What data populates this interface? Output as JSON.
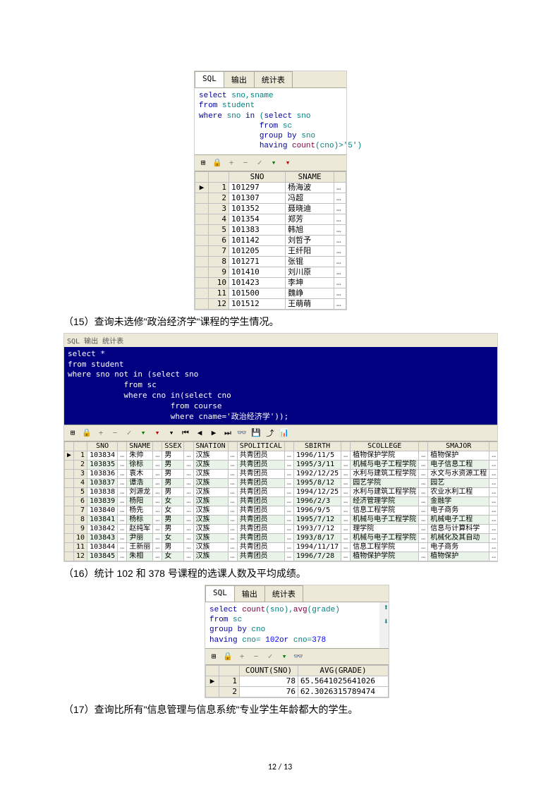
{
  "tabs": {
    "sql": "SQL",
    "output": "输出",
    "stats": "统计表"
  },
  "fig1": {
    "sql_lines": [
      {
        "pre": "",
        "kw": "select ",
        "text": "sno,sname"
      },
      {
        "pre": "",
        "kw": "from ",
        "text": "student"
      },
      {
        "pre": "",
        "kw": "where ",
        "text": "sno ",
        "kw2": "in ",
        "text2": "(",
        "kw3": "select ",
        "text3": "sno"
      },
      {
        "pre": "             ",
        "kw": "from ",
        "text": "sc"
      },
      {
        "pre": "             ",
        "kw": "group by ",
        "text": "sno"
      },
      {
        "pre": "             ",
        "kw": "having ",
        "fn": "count",
        "text": "(cno)>'5')"
      }
    ],
    "toolbar_icons": [
      "grid-icon",
      "lock-icon",
      "plus-icon",
      "minus-icon",
      "check-icon",
      "down-green-icon",
      "down-red-icon"
    ],
    "headers": [
      "SNO",
      "SNAME"
    ],
    "rows": [
      {
        "marker": "▶",
        "n": "1",
        "sno": "101297",
        "sname": "杨海波"
      },
      {
        "marker": "",
        "n": "2",
        "sno": "101307",
        "sname": "冯超"
      },
      {
        "marker": "",
        "n": "3",
        "sno": "101352",
        "sname": "聂晓迪"
      },
      {
        "marker": "",
        "n": "4",
        "sno": "101354",
        "sname": "郑芳"
      },
      {
        "marker": "",
        "n": "5",
        "sno": "101383",
        "sname": "韩旭"
      },
      {
        "marker": "",
        "n": "6",
        "sno": "101142",
        "sname": "刘哲予"
      },
      {
        "marker": "",
        "n": "7",
        "sno": "101205",
        "sname": "王纤阳"
      },
      {
        "marker": "",
        "n": "8",
        "sno": "101271",
        "sname": "张锟"
      },
      {
        "marker": "",
        "n": "9",
        "sno": "101410",
        "sname": "刘川原"
      },
      {
        "marker": "",
        "n": "10",
        "sno": "101423",
        "sname": "李坤"
      },
      {
        "marker": "",
        "n": "11",
        "sno": "101500",
        "sname": "魏峥"
      },
      {
        "marker": "",
        "n": "12",
        "sno": "101512",
        "sname": "王萌萌"
      }
    ]
  },
  "caption15": "（15）查询未选修\"政治经济学\"课程的学生情况。",
  "fig2": {
    "tabs_small": "SQL   输出   统计表",
    "sql_text": "select *\nfrom student\nwhere sno not in (select sno\n            from sc\n            where cno in(select cno\n                      from course\n                      where cname='政治经济学'));",
    "toolbar_icons": [
      "grid-icon",
      "lock-icon",
      "plus-icon",
      "minus-icon",
      "check-icon",
      "down-green-icon",
      "down-red-icon",
      "down2-icon",
      "nav-first",
      "nav-prev",
      "nav-next",
      "nav-last",
      "binoculars-icon",
      "save-icon",
      "export-icon",
      "chart-icon"
    ],
    "headers": [
      "SNO",
      "SNAME",
      "SSEX",
      "SNATION",
      "SPOLITICAL",
      "SBIRTH",
      "SCOLLEGE",
      "SMAJOR"
    ],
    "rows": [
      {
        "marker": "▶",
        "n": "1",
        "v": [
          "103834",
          "朱帅",
          "男",
          "汉族",
          "共青团员",
          "1996/11/5",
          "植物保护学院",
          "植物保护"
        ]
      },
      {
        "marker": "",
        "n": "2",
        "v": [
          "103835",
          "徐标",
          "男",
          "汉族",
          "共青团员",
          "1995/3/11",
          "机械与电子工程学院",
          "电子信息工程"
        ]
      },
      {
        "marker": "",
        "n": "3",
        "v": [
          "103836",
          "袁木",
          "男",
          "汉族",
          "共青团员",
          "1992/12/25",
          "水利与建筑工程学院",
          "水文与水资源工程"
        ]
      },
      {
        "marker": "",
        "n": "4",
        "v": [
          "103837",
          "谭浩",
          "男",
          "汉族",
          "共青团员",
          "1995/8/12",
          "园艺学院",
          "园艺"
        ]
      },
      {
        "marker": "",
        "n": "5",
        "v": [
          "103838",
          "刘源龙",
          "男",
          "汉族",
          "共青团员",
          "1994/12/25",
          "水利与建筑工程学院",
          "农业水利工程"
        ]
      },
      {
        "marker": "",
        "n": "6",
        "v": [
          "103839",
          "杨阳",
          "女",
          "汉族",
          "共青团员",
          "1996/2/3",
          "经济管理学院",
          "金融学"
        ]
      },
      {
        "marker": "",
        "n": "7",
        "v": [
          "103840",
          "杨先",
          "女",
          "汉族",
          "共青团员",
          "1996/9/5",
          "信息工程学院",
          "电子商务"
        ]
      },
      {
        "marker": "",
        "n": "8",
        "v": [
          "103841",
          "杨标",
          "男",
          "汉族",
          "共青团员",
          "1995/7/12",
          "机械与电子工程学院",
          "机械电子工程"
        ]
      },
      {
        "marker": "",
        "n": "9",
        "v": [
          "103842",
          "赵纯军",
          "男",
          "汉族",
          "共青团员",
          "1993/7/12",
          "理学院",
          "信息与计算科学"
        ]
      },
      {
        "marker": "",
        "n": "10",
        "v": [
          "103843",
          "尹丽",
          "女",
          "汉族",
          "共青团员",
          "1993/8/17",
          "机械与电子工程学院",
          "机械化及其自动"
        ]
      },
      {
        "marker": "",
        "n": "11",
        "v": [
          "103844",
          "王新丽",
          "男",
          "汉族",
          "共青团员",
          "1994/11/17",
          "信息工程学院",
          "电子商务"
        ]
      },
      {
        "marker": "",
        "n": "12",
        "v": [
          "103845",
          "朱相",
          "女",
          "汉族",
          "共青团员",
          "1996/7/28",
          "植物保护学院",
          "植物保护"
        ]
      }
    ]
  },
  "caption16": "（16）统计 102 和 378 号课程的选课人数及平均成绩。",
  "fig3": {
    "sql_lines": [
      {
        "pre": "",
        "kw": "select ",
        "fn": "count",
        "text": "(sno),",
        "fn2": "avg",
        "text2": "(grade)"
      },
      {
        "pre": "",
        "kw": "from ",
        "text": "sc"
      },
      {
        "pre": "",
        "kw": "group by ",
        "text": "cno"
      },
      {
        "pre": "",
        "kw": "having ",
        "text": "cno=",
        "num": "102",
        "text2": " ",
        "kw2": "or",
        "text3": " cno=",
        "num2": "378"
      }
    ],
    "toolbar_icons": [
      "grid-icon",
      "lock-icon",
      "plus-icon",
      "minus-icon",
      "check-icon",
      "down-green-icon",
      "binoculars-icon"
    ],
    "headers": [
      "COUNT(SNO)",
      "AVG(GRADE)"
    ],
    "rows": [
      {
        "marker": "▶",
        "n": "1",
        "count": "78",
        "avg": "65.5641025641026"
      },
      {
        "marker": "",
        "n": "2",
        "count": "76",
        "avg": "62.3026315789474"
      }
    ],
    "arrow_up": "⬆",
    "arrow_down": "⬇"
  },
  "caption17": "（17）查询比所有\"信息管理与信息系统\"专业学生年龄都大的学生。",
  "footer": "12  /  13"
}
